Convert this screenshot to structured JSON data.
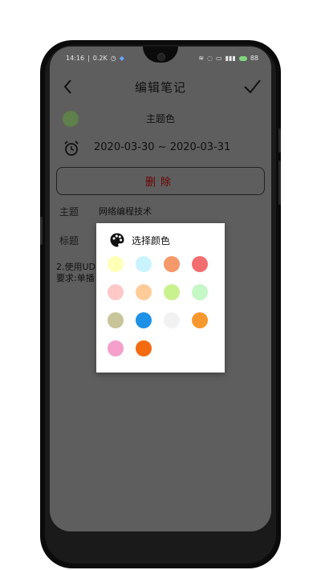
{
  "status_bar": {
    "time": "14:16",
    "net_speed": "0.2K",
    "battery": "88"
  },
  "header": {
    "title": "编辑笔记"
  },
  "theme": {
    "label": "主题色",
    "current_color": "#5f7f4b"
  },
  "dates": {
    "range": "2020-03-30 ~ 2020-03-31"
  },
  "delete_button": {
    "label": "删除"
  },
  "fields": {
    "subject_label": "主题",
    "subject_value": "网络编程技术",
    "title_label": "标题"
  },
  "content": {
    "line1": "2.使用UD",
    "line2": "要求:单播"
  },
  "color_dialog": {
    "title": "选择颜色",
    "colors": [
      "#ffffb8",
      "#c9f4ff",
      "#f5986a",
      "#f26d6f",
      "#ffc8c8",
      "#ffcc99",
      "#c9f28e",
      "#c6f7c6",
      "#c9c59a",
      "#1e90e6",
      "#f2f2f2",
      "#f7982f",
      "#f59fcb",
      "#f46a10"
    ]
  },
  "icons": {
    "back": "chevron-left-icon",
    "confirm": "check-icon",
    "alarm": "alarm-clock-icon",
    "palette": "palette-icon"
  }
}
